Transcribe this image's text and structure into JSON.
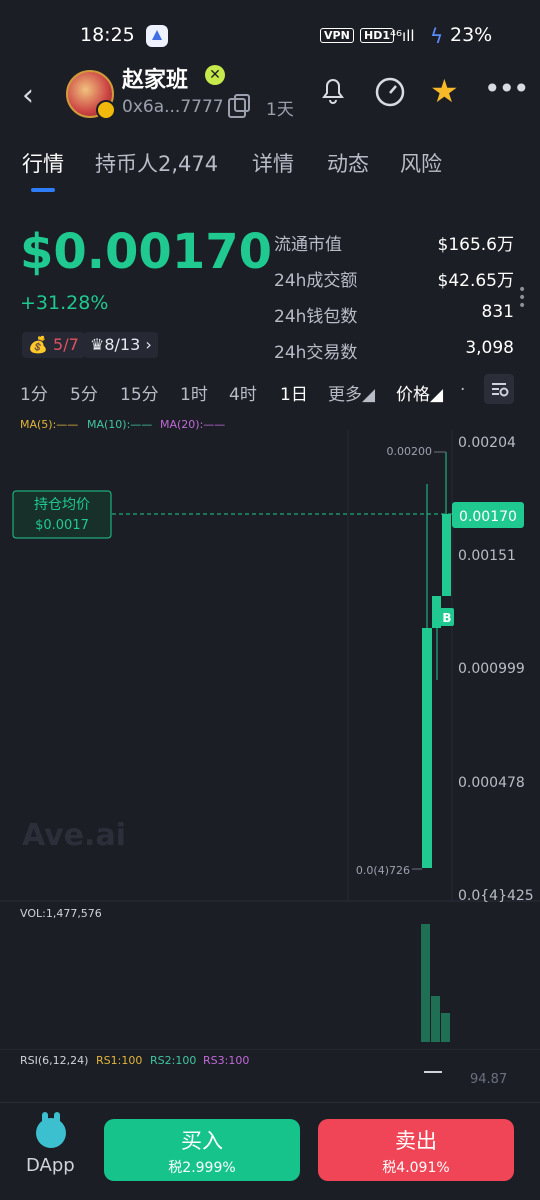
{
  "status": {
    "time": "18:25",
    "vpn": "VPN",
    "hd": "HD1",
    "signal": "⁴⁶ıll",
    "battery": "23%"
  },
  "header": {
    "token_name": "赵家班",
    "address": "0x6a...7777",
    "age": "1天"
  },
  "tabs": [
    {
      "label": "行情",
      "active": true
    },
    {
      "label": "持币人2,474"
    },
    {
      "label": "详情"
    },
    {
      "label": "动态"
    },
    {
      "label": "风险"
    }
  ],
  "price": {
    "value": "$0.00170",
    "change": "+31.28%",
    "badge1": "5/7",
    "badge2": "8/13"
  },
  "stats": [
    {
      "k": "流通市值",
      "v": "$165.6万"
    },
    {
      "k": "24h成交额",
      "v": "$42.65万"
    },
    {
      "k": "24h钱包数",
      "v": "831"
    },
    {
      "k": "24h交易数",
      "v": "3,098"
    }
  ],
  "timeframes": [
    "1分",
    "5分",
    "15分",
    "1时",
    "4时",
    "1日",
    "更多◢",
    "价格◢",
    "·"
  ],
  "active_timeframe": "1日",
  "ma": {
    "ma5": "MA(5):——",
    "ma10": "MA(10):——",
    "ma20": "MA(20):——"
  },
  "chart": {
    "axis_labels": [
      "0.00204",
      "0.00151",
      "0.000999",
      "0.000478",
      "0.0{4}425"
    ],
    "current_price_tag": "0.00170",
    "high_label": "0.00200",
    "low_label": "0.0(4)726",
    "avg_label_title": "持仓均价",
    "avg_label_value": "$0.0017",
    "marker": "B",
    "watermark": "Ave.ai"
  },
  "volume": {
    "label": "VOL:1,477,576"
  },
  "rsi": {
    "label": "RSI(6,12,24)",
    "rs1": "RS1:100",
    "rs2": "RS2:100",
    "rs3": "RS3:100",
    "value": "94.87"
  },
  "bottom": {
    "dapp": "DApp",
    "buy": {
      "label": "买入",
      "tax": "税2.999%"
    },
    "sell": {
      "label": "卖出",
      "tax": "税4.091%"
    }
  }
}
